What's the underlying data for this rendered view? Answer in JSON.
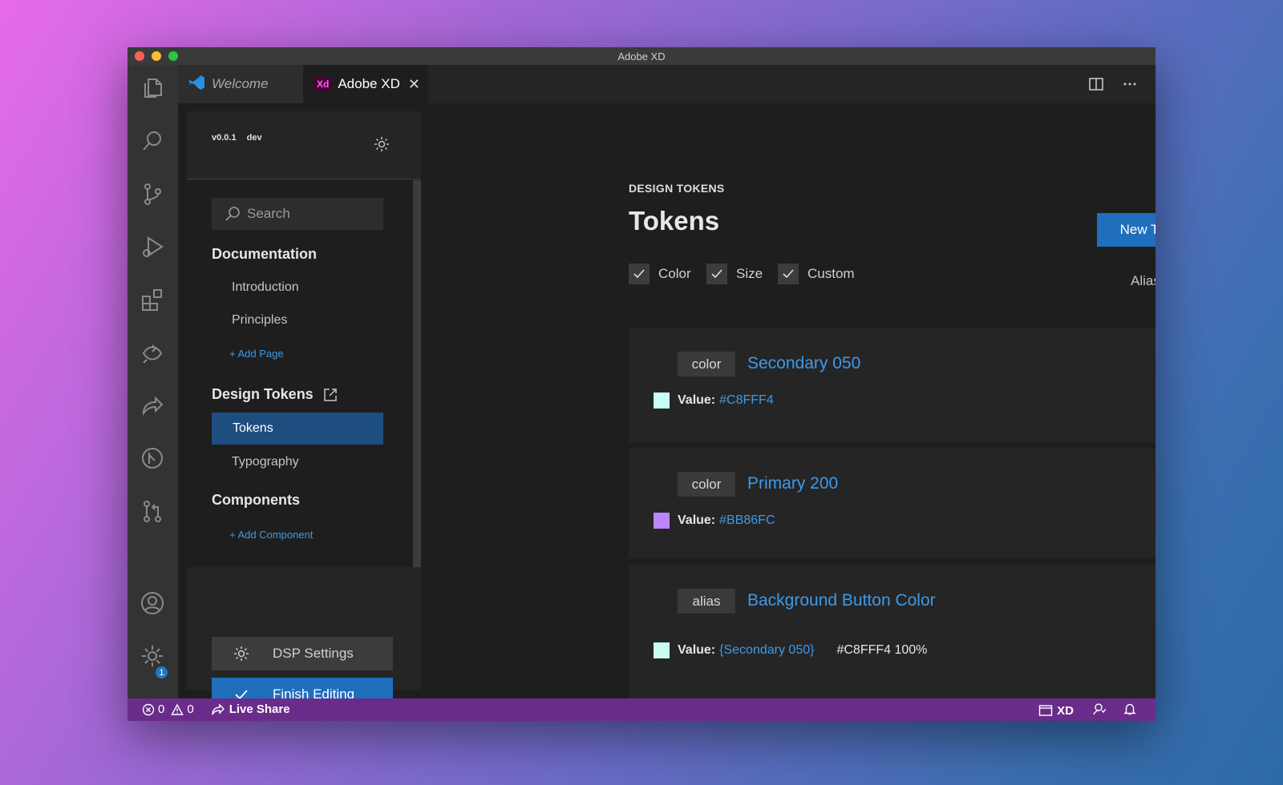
{
  "window": {
    "title": "Adobe XD"
  },
  "tabs": [
    {
      "label": "Welcome",
      "active": false
    },
    {
      "label": "Adobe XD",
      "active": true,
      "icon_text": "Xd"
    }
  ],
  "panel": {
    "version": "v0.0.1",
    "channel": "dev",
    "search_placeholder": "Search",
    "sections": {
      "documentation": "Documentation",
      "introduction": "Introduction",
      "principles": "Principles",
      "add_page": "+ Add Page",
      "design_tokens": "Design Tokens",
      "tokens": "Tokens",
      "typography": "Typography",
      "components": "Components",
      "add_component": "+ Add Component"
    },
    "buttons": {
      "dsp_settings": "DSP Settings",
      "finish_editing": "Finish Editing"
    }
  },
  "main": {
    "overline": "DESIGN TOKENS",
    "title": "Tokens",
    "new_token": "New Token",
    "filters": [
      {
        "label": "Color",
        "checked": true
      },
      {
        "label": "Size",
        "checked": true
      },
      {
        "label": "Custom",
        "checked": true
      }
    ],
    "aliases_label": "Aliases",
    "value_label": "Value:",
    "tokens": [
      {
        "type": "color",
        "name": "Secondary 050",
        "value": "#C8FFF4",
        "swatch": "#C8FFF4"
      },
      {
        "type": "color",
        "name": "Primary 200",
        "value": "#BB86FC",
        "swatch": "#BB86FC"
      },
      {
        "type": "alias",
        "name": "Background Button Color",
        "value": "{Secondary 050}",
        "resolved": "#C8FFF4 100%",
        "swatch": "#C8FFF4"
      }
    ]
  },
  "status": {
    "errors": "0",
    "warnings": "0",
    "live_share": "Live Share",
    "xd_label": "XD",
    "account_badge": "1"
  },
  "colors": {
    "accent": "#1f6fbd",
    "link": "#3d9ae8",
    "status_bar": "#6a2c8a"
  }
}
